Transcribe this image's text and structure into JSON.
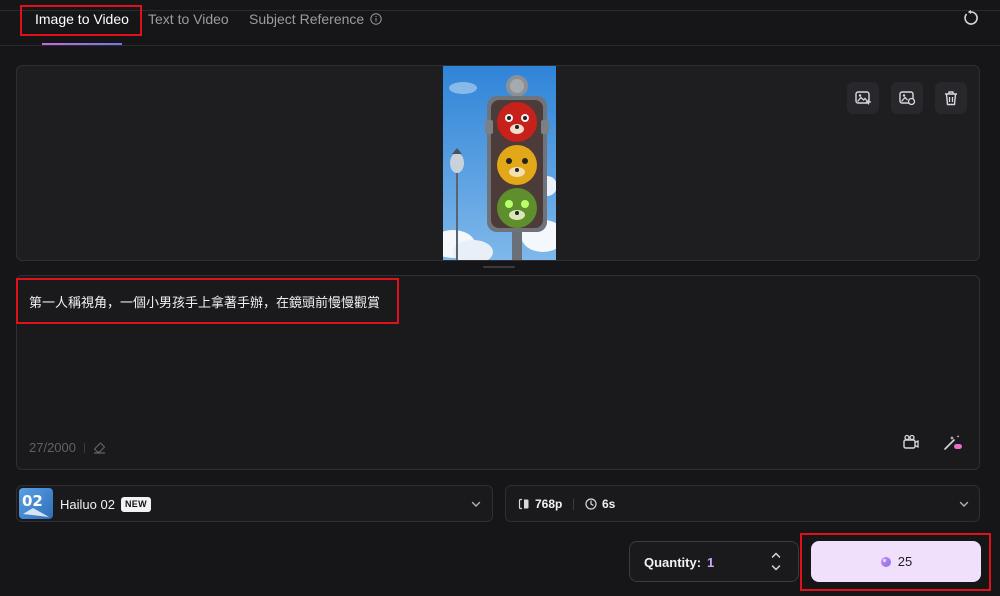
{
  "tabs": [
    {
      "label": "Image to Video",
      "active": true
    },
    {
      "label": "Text to Video",
      "active": false
    },
    {
      "label": "Subject Reference",
      "active": false
    }
  ],
  "icons": {
    "info": "info-icon",
    "reset": "rotate-ccw-icon",
    "image_actions": [
      "image-edit-icon",
      "image-settings-icon",
      "trash-icon"
    ],
    "prompt_actions": [
      "camera-movement-icon",
      "magic-wand-icon"
    ],
    "eraser": "eraser-icon",
    "chevron": "chevron-down-icon",
    "gem": "gem-icon"
  },
  "prompt": {
    "text": "第一人稱視角，一個小男孩手上拿著手辦，在鏡頭前慢慢觀賞",
    "counter": "27/2000"
  },
  "model": {
    "logo_text": "02",
    "name": "Hailuo 02",
    "badge": "NEW"
  },
  "settings": {
    "resolution": "768p",
    "duration": "6s"
  },
  "quantity": {
    "label": "Quantity:",
    "value": "1"
  },
  "generate": {
    "cost": "25"
  },
  "colors": {
    "background": "#161618",
    "panel": "#1e1e21",
    "accent": "#c9a7ff",
    "generate_bg": "#f1e0fb",
    "highlight": "#e0111a"
  }
}
